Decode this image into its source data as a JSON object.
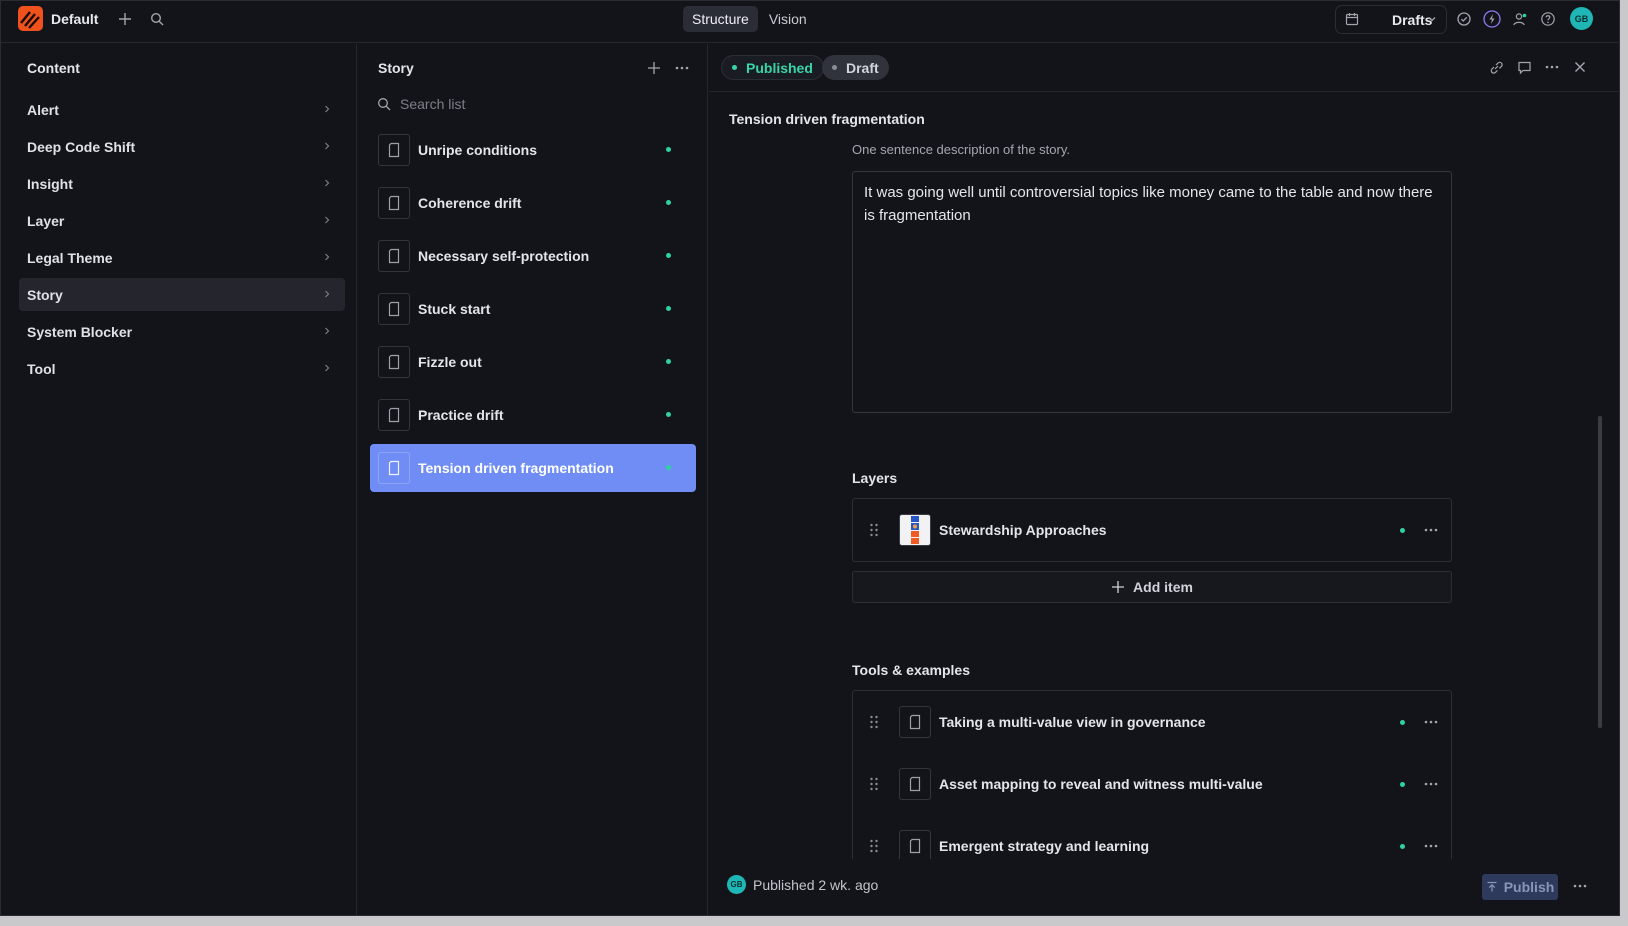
{
  "topbar": {
    "workspace": "Default",
    "mode_tabs": [
      "Structure",
      "Vision"
    ],
    "active_mode": "Structure",
    "release_selector": "Drafts",
    "user_initials": "GB"
  },
  "content_pane": {
    "title": "Content",
    "items": [
      {
        "label": "Alert"
      },
      {
        "label": "Deep Code Shift"
      },
      {
        "label": "Insight"
      },
      {
        "label": "Layer"
      },
      {
        "label": "Legal Theme"
      },
      {
        "label": "Story",
        "active": true
      },
      {
        "label": "System Blocker"
      },
      {
        "label": "Tool"
      }
    ]
  },
  "list_pane": {
    "title": "Story",
    "search_placeholder": "Search list",
    "items": [
      {
        "label": "Unripe conditions"
      },
      {
        "label": "Coherence drift"
      },
      {
        "label": "Necessary self-protection"
      },
      {
        "label": "Stuck start"
      },
      {
        "label": "Fizzle out"
      },
      {
        "label": "Practice drift"
      },
      {
        "label": "Tension driven fragmentation",
        "active": true
      }
    ]
  },
  "editor": {
    "badges": {
      "published": "Published",
      "draft": "Draft"
    },
    "document_title": "Tension driven fragmentation",
    "description_hint": "One sentence description of the story.",
    "description_value": "It was going well until controversial topics like money came to the table and now there is fragmentation",
    "layers": {
      "label": "Layers",
      "items": [
        {
          "label": "Stewardship Approaches"
        }
      ],
      "add_label": "Add item"
    },
    "tools": {
      "label": "Tools & examples",
      "items": [
        {
          "label": "Taking a multi-value view in governance"
        },
        {
          "label": "Asset mapping to reveal and witness multi-value"
        },
        {
          "label": "Emergent strategy and learning"
        }
      ]
    },
    "footer": {
      "status": "Published 2 wk. ago",
      "publish_label": "Publish"
    }
  },
  "colors": {
    "accent": "#6f8df5",
    "published": "#37d6a6",
    "brand": "#f0521d"
  }
}
